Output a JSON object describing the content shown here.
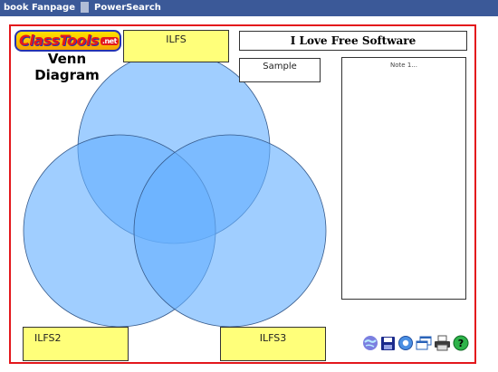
{
  "topbar": {
    "links": [
      "book Fanpage",
      "PowerSearch"
    ]
  },
  "logo": {
    "text": "ClassTools",
    "suffix": ".net"
  },
  "venn_title": {
    "line1": "Venn",
    "line2": "Diagram"
  },
  "labels": {
    "circle1": "ILFS",
    "circle2": "ILFS2",
    "circle3": "ILFS3"
  },
  "title_box": "I Love Free Software",
  "sample_box": "Sample",
  "note_box": "Note 1...",
  "colors": {
    "topbar": "#3b5998",
    "frame_border": "#e3171c",
    "label_fill": "#ffff7a",
    "circle_fill": "#66b0ff"
  },
  "toolbar_icons": [
    "globe-icon",
    "save-icon",
    "settings-icon",
    "windows-icon",
    "print-icon",
    "help-icon"
  ]
}
